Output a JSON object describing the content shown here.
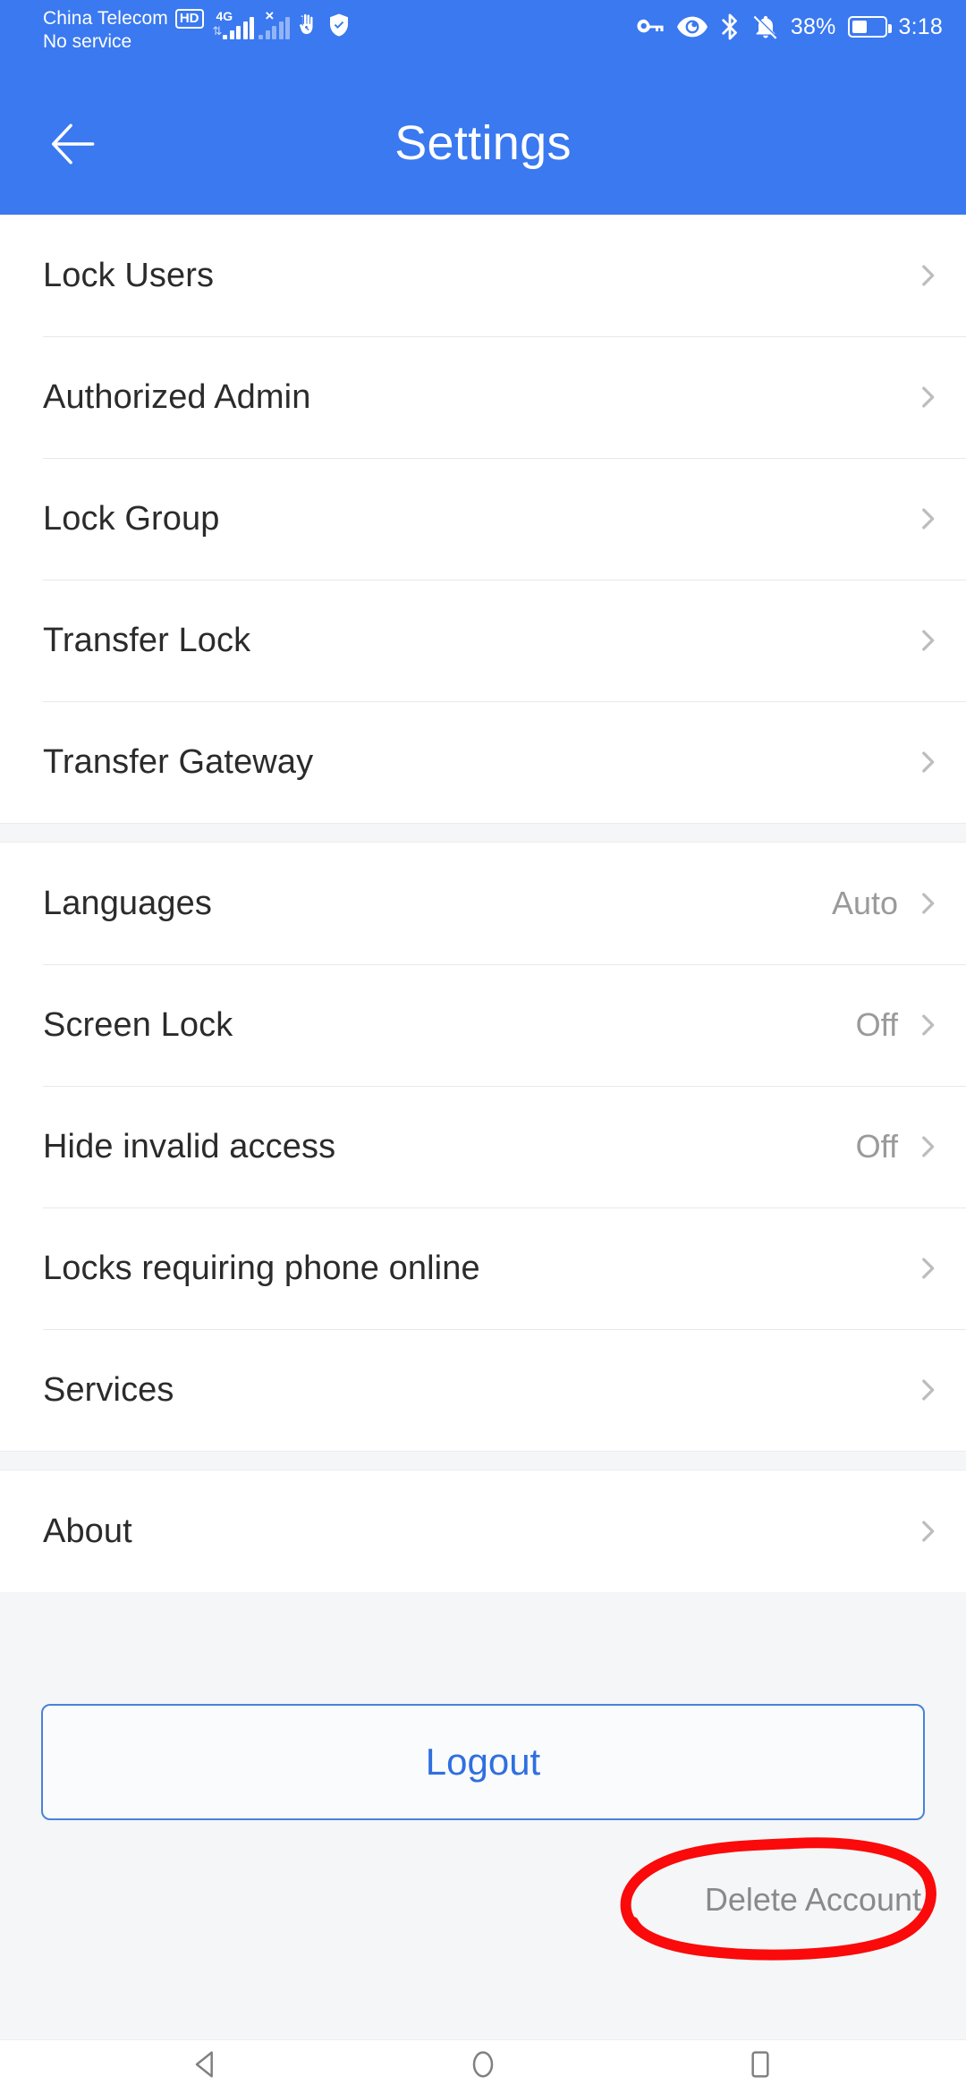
{
  "statusbar": {
    "carrier_name": "China Telecom",
    "hd_badge": "HD",
    "carrier_sub": "No service",
    "network_type": "4G",
    "sim2_x": "×",
    "icons_left": [
      "signal-bars-icon",
      "no-sim-signal-icon",
      "hand-icon",
      "shield-check-icon"
    ],
    "icons_right": [
      "key-icon",
      "eye-icon",
      "bluetooth-icon",
      "bell-off-icon"
    ],
    "battery_percent": "38%",
    "time": "3:18"
  },
  "appbar": {
    "title": "Settings",
    "back_icon": "back-arrow-icon"
  },
  "groups": [
    {
      "rows": [
        {
          "label": "Lock Users",
          "value": ""
        },
        {
          "label": "Authorized Admin",
          "value": ""
        },
        {
          "label": "Lock Group",
          "value": ""
        },
        {
          "label": "Transfer Lock",
          "value": ""
        },
        {
          "label": "Transfer Gateway",
          "value": ""
        }
      ]
    },
    {
      "rows": [
        {
          "label": "Languages",
          "value": "Auto"
        },
        {
          "label": "Screen Lock",
          "value": "Off"
        },
        {
          "label": "Hide invalid access",
          "value": "Off"
        },
        {
          "label": "Locks requiring phone online",
          "value": ""
        },
        {
          "label": "Services",
          "value": ""
        }
      ]
    },
    {
      "rows": [
        {
          "label": "About",
          "value": ""
        }
      ]
    }
  ],
  "footer": {
    "logout_label": "Logout",
    "delete_account_label": "Delete Account",
    "annotation": "red-ellipse-highlight"
  },
  "navbar": {
    "back_label": "back-triangle-icon",
    "home_label": "home-circle-icon",
    "recents_label": "recents-square-icon"
  },
  "colors": {
    "brand_blue": "#3a79f0",
    "logout_blue": "#2f6fe0",
    "annotation_red": "#fa0a0a",
    "page_bg": "#f5f6f7",
    "row_bg": "#ffffff",
    "label_text": "#2b2b2b",
    "value_text": "#9a9a9a",
    "chevron": "#bdbdbd"
  }
}
